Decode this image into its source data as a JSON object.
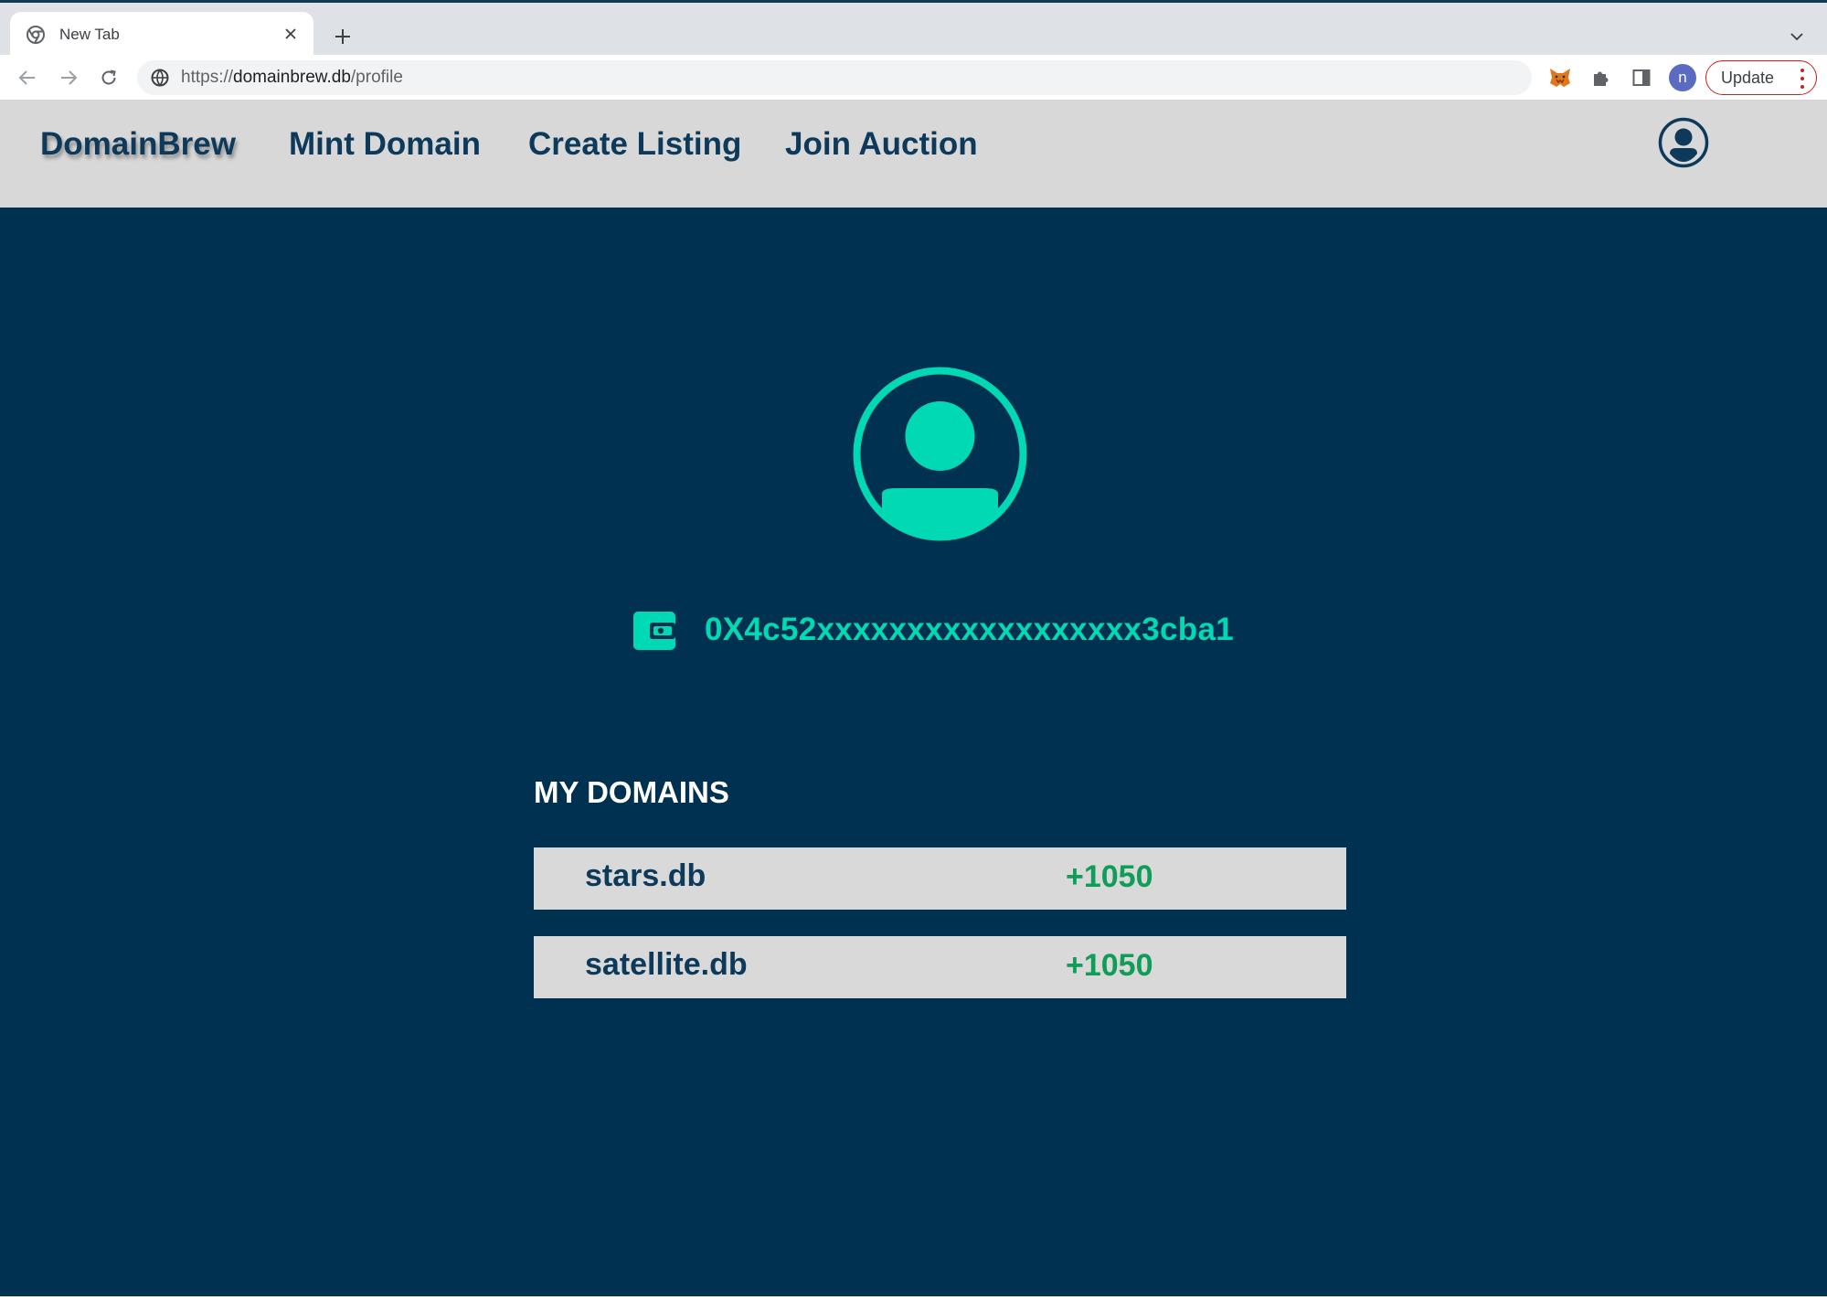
{
  "browser": {
    "tab": {
      "title": "New Tab",
      "favicon": "chrome-icon",
      "close_icon": "close-icon"
    },
    "new_tab_icon": "plus-icon",
    "tab_list_icon": "chevron-down-icon",
    "omnibox": {
      "site_icon": "site-info-icon",
      "url_scheme": "https://",
      "url_host": "domainbrew.db",
      "url_path": "/profile"
    },
    "extensions": [
      "metamask-fox-icon",
      "puzzle-extensions-icon",
      "side-panel-icon"
    ],
    "profile_initial": "n",
    "update_label": "Update"
  },
  "header": {
    "brand": "DomainBrew",
    "nav": [
      {
        "label": "Mint Domain"
      },
      {
        "label": "Create Listing"
      },
      {
        "label": "Join Auction"
      }
    ],
    "account_icon": "user-circle-icon"
  },
  "profile": {
    "avatar_icon": "user-avatar-icon",
    "wallet_icon": "wallet-icon",
    "address": "0X4c52xxxxxxxxxxxxxxxxxx3cba1"
  },
  "domains": {
    "heading": "MY DOMAINS",
    "items": [
      {
        "name": "stars.db",
        "value": "+1050"
      },
      {
        "name": "satellite.db",
        "value": "+1050"
      }
    ]
  },
  "colors": {
    "header_bg": "#d8d8d8",
    "main_bg": "#013150",
    "accent": "#00d9b4",
    "brand_text": "#0d3a5a",
    "positive": "#0f9d58"
  }
}
